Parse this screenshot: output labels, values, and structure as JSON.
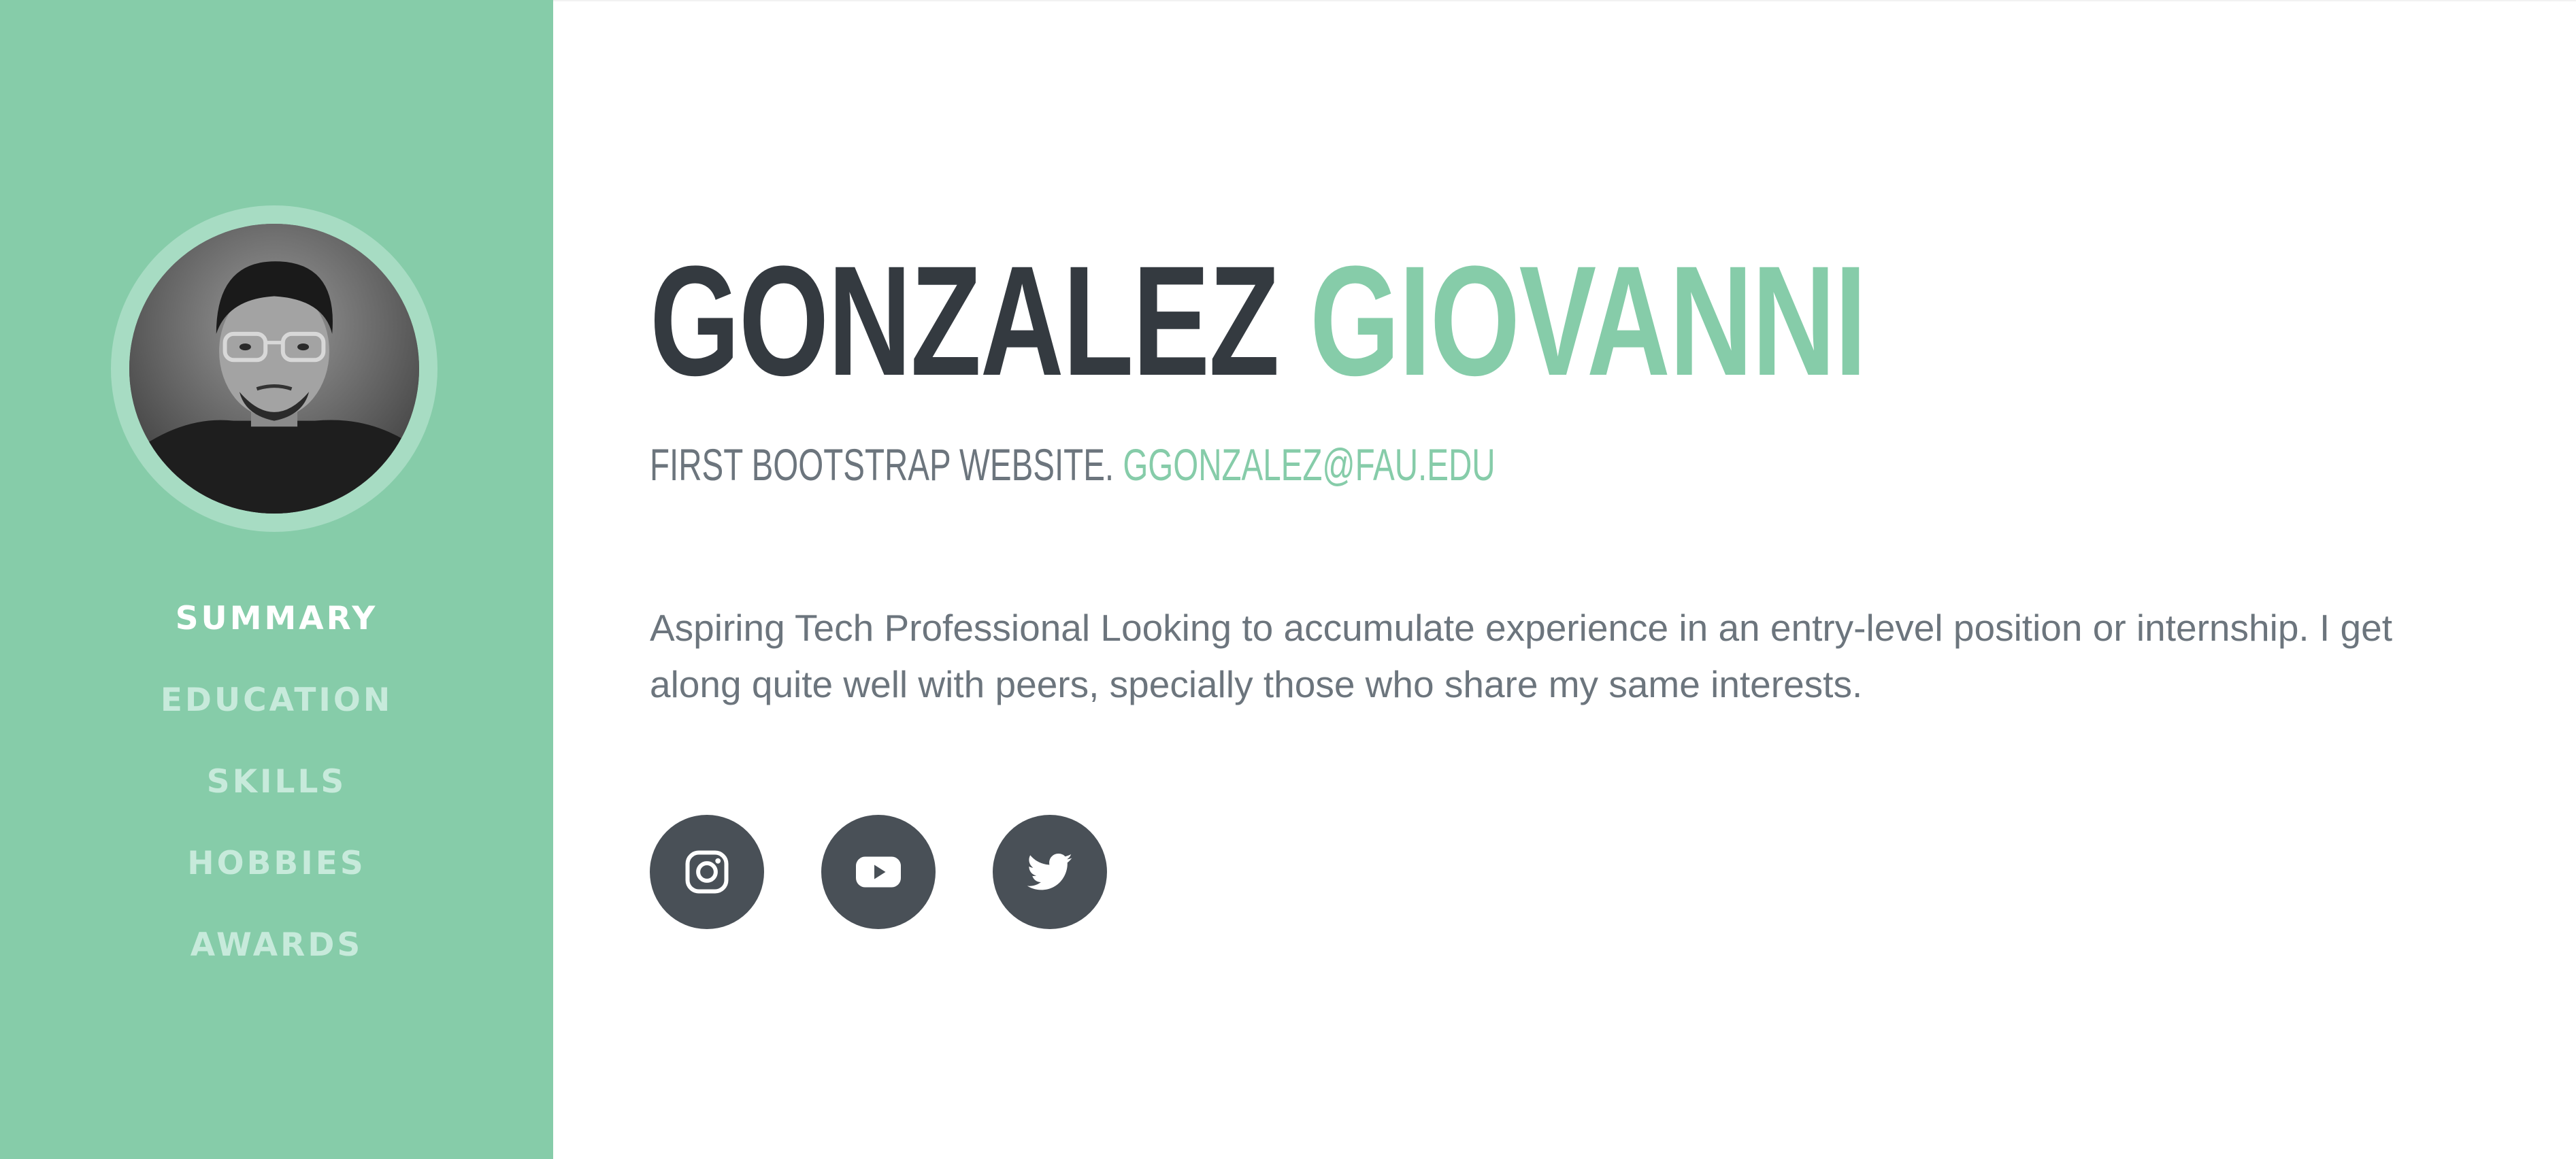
{
  "sidebar": {
    "nav": [
      {
        "label": "SUMMARY",
        "active": true
      },
      {
        "label": "EDUCATION",
        "active": false
      },
      {
        "label": "SKILLS",
        "active": false
      },
      {
        "label": "HOBBIES",
        "active": false
      },
      {
        "label": "AWARDS",
        "active": false
      }
    ]
  },
  "header": {
    "last_name": "GONZALEZ",
    "first_name": "GIOVANNI",
    "tagline": "FIRST BOOTSTRAP WEBSITE.",
    "email": "GGONZALEZ@FAU.EDU"
  },
  "summary": {
    "text": "Aspiring Tech Professional Looking to accumulate experience in an entry-level position or internship. I get along quite well with peers, specially those who share my same interests."
  },
  "social": {
    "icons": [
      "instagram-icon",
      "youtube-icon",
      "twitter-icon"
    ]
  },
  "colors": {
    "accent": "#86cca9",
    "dark": "#343a40",
    "muted": "#6c757d",
    "social_button": "#495057"
  }
}
